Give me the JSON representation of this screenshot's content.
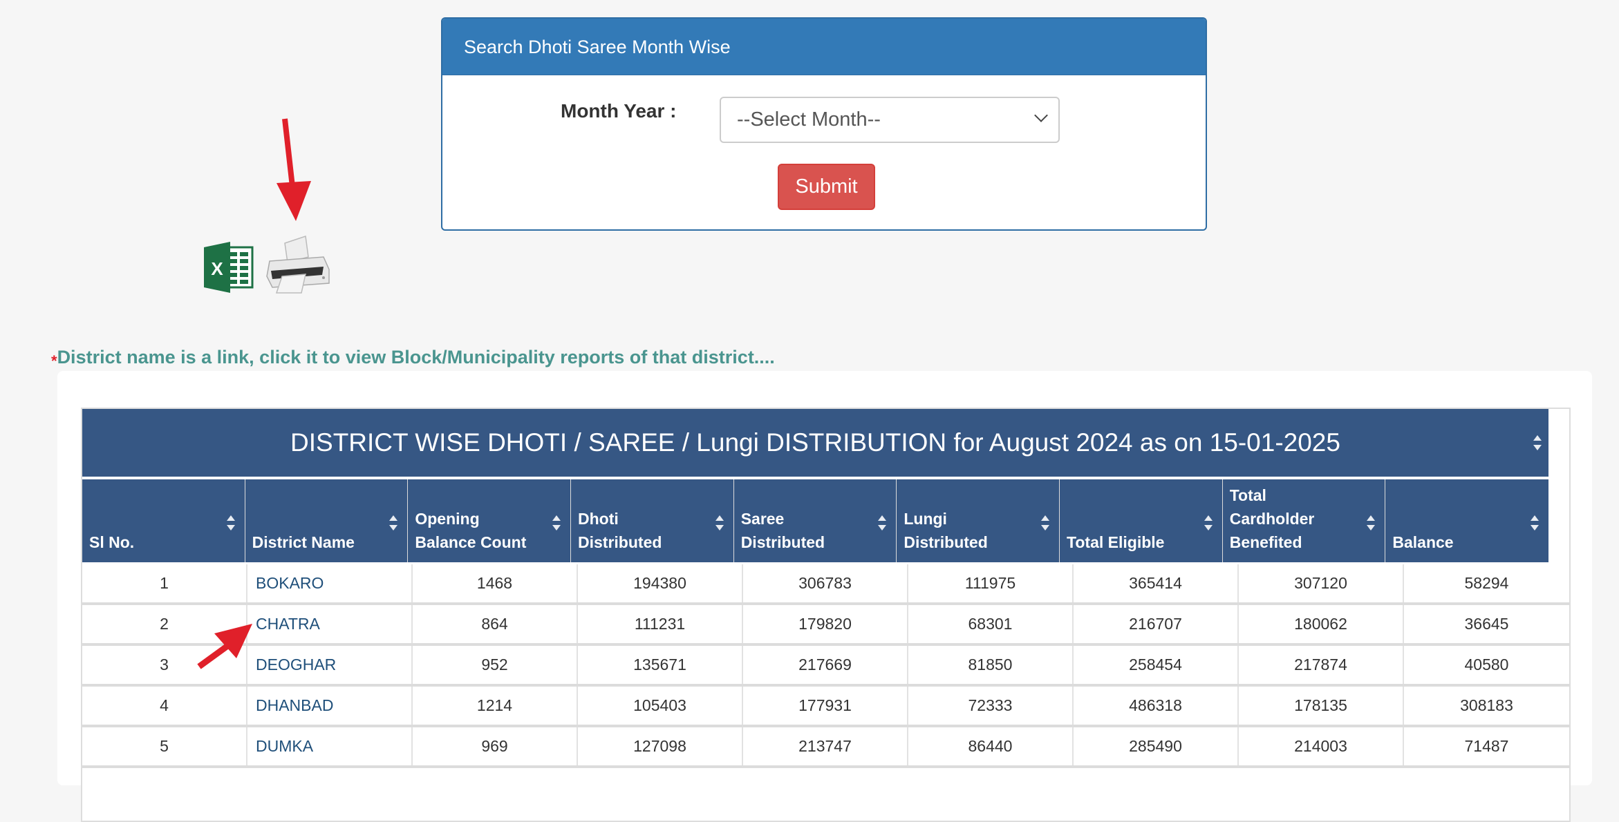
{
  "search_panel": {
    "title": "Search Dhoti Saree Month Wise",
    "month_label": "Month Year :",
    "month_select_value": "--Select Month--",
    "submit_label": "Submit"
  },
  "export": {
    "excel_icon": "excel-icon",
    "print_icon": "printer-icon"
  },
  "notice": {
    "marker": "*",
    "text": "District name is a link, click it to view Block/Municipality reports of that district...."
  },
  "table": {
    "title": "DISTRICT WISE DHOTI / SAREE / Lungi DISTRIBUTION for August 2024 as on 15-01-2025",
    "columns": [
      {
        "line1": "",
        "line2": "",
        "line3": "Sl No."
      },
      {
        "line1": "",
        "line2": "",
        "line3": "District Name"
      },
      {
        "line1": "",
        "line2": "Opening",
        "line3": "Balance Count"
      },
      {
        "line1": "",
        "line2": "Dhoti",
        "line3": "Distributed"
      },
      {
        "line1": "",
        "line2": "Saree",
        "line3": "Distributed"
      },
      {
        "line1": "",
        "line2": "Lungi",
        "line3": "Distributed"
      },
      {
        "line1": "",
        "line2": "",
        "line3": "Total Eligible"
      },
      {
        "line1": "Total",
        "line2": "Cardholder",
        "line3": "Benefited"
      },
      {
        "line1": "",
        "line2": "",
        "line3": "Balance"
      }
    ],
    "rows": [
      [
        "1",
        "BOKARO",
        "1468",
        "194380",
        "306783",
        "111975",
        "365414",
        "307120",
        "58294"
      ],
      [
        "2",
        "CHATRA",
        "864",
        "111231",
        "179820",
        "68301",
        "216707",
        "180062",
        "36645"
      ],
      [
        "3",
        "DEOGHAR",
        "952",
        "135671",
        "217669",
        "81850",
        "258454",
        "217874",
        "40580"
      ],
      [
        "4",
        "DHANBAD",
        "1214",
        "105403",
        "177931",
        "72333",
        "486318",
        "178135",
        "308183"
      ],
      [
        "5",
        "DUMKA",
        "969",
        "127098",
        "213747",
        "86440",
        "285490",
        "214003",
        "71487"
      ]
    ]
  },
  "colors": {
    "panel_header": "#337ab7",
    "table_header": "#365784",
    "submit": "#d9534f",
    "notice_text": "#4a958f",
    "district_link": "#1f4f7a",
    "annotation_arrow": "#e0202a"
  }
}
